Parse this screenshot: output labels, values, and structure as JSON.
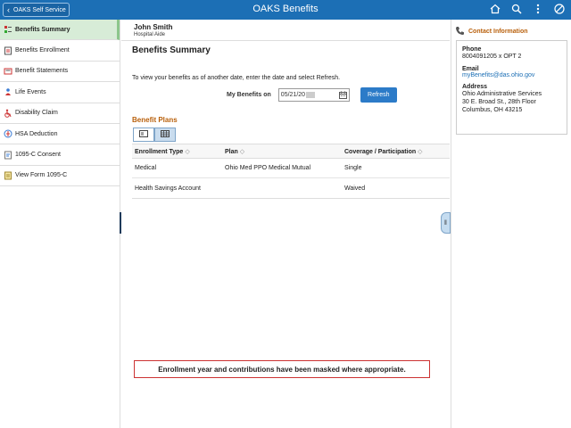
{
  "header": {
    "back_label": "OAKS Self Service",
    "title": "OAKS Benefits",
    "icons": [
      "home-icon",
      "search-icon",
      "more-vertical-icon",
      "no-entry-icon"
    ]
  },
  "nav": {
    "items": [
      {
        "label": "Benefits Summary",
        "icon": "benefits-summary-icon",
        "active": true
      },
      {
        "label": "Benefits Enrollment",
        "icon": "enrollment-icon"
      },
      {
        "label": "Benefit Statements",
        "icon": "statements-icon"
      },
      {
        "label": "Life Events",
        "icon": "life-events-icon"
      },
      {
        "label": "Disability Claim",
        "icon": "wheelchair-icon"
      },
      {
        "label": "HSA Deduction",
        "icon": "hsa-icon"
      },
      {
        "label": "1095-C Consent",
        "icon": "consent-icon"
      },
      {
        "label": "View Form 1095-C",
        "icon": "form-icon"
      }
    ]
  },
  "person": {
    "name": "John Smith",
    "title": "Hospital Aide"
  },
  "main": {
    "page_title": "Benefits Summary",
    "instruction": "To view your benefits as of another date, enter the date and select Refresh.",
    "date_label": "My Benefits on",
    "date_value": "05/21/20",
    "refresh_label": "Refresh",
    "section_title": "Benefit Plans",
    "columns": [
      "Enrollment Type",
      "Plan",
      "Coverage / Participation"
    ],
    "rows": [
      {
        "type": "Medical",
        "plan": "Ohio Med PPO Medical Mutual",
        "coverage": "Single"
      },
      {
        "type": "Health Savings Account",
        "plan": "",
        "coverage": "Waived"
      }
    ],
    "mask_note": "Enrollment year and contributions have been masked where appropriate."
  },
  "contact": {
    "title": "Contact Information",
    "phone_label": "Phone",
    "phone": "8004091205 x OPT 2",
    "email_label": "Email",
    "email": "myBenefits@das.ohio.gov",
    "address_label": "Address",
    "address_line1": "Ohio Administrative Services",
    "address_line2": "30 E. Broad St., 28th Floor",
    "address_line3": "Columbus, OH 43215"
  },
  "colors": {
    "header": "#1c6fb5",
    "accent": "#b85f0a",
    "active_nav": "#d7ecd7"
  }
}
